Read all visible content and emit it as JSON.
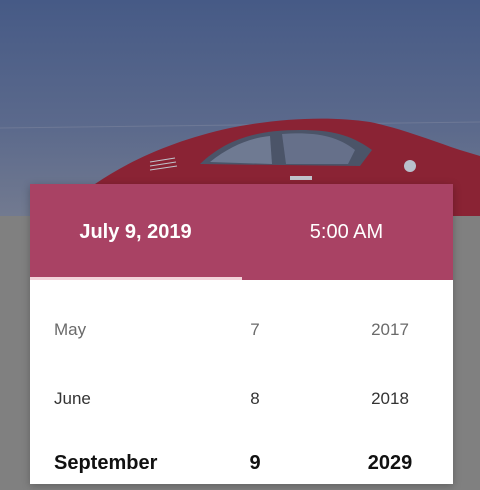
{
  "header": {
    "date_label": "July 9, 2019",
    "time_label": "5:00 AM"
  },
  "picker": {
    "months": [
      "May",
      "June",
      "September"
    ],
    "days": [
      "7",
      "8",
      "9"
    ],
    "years": [
      "2017",
      "2018",
      "2029"
    ]
  },
  "colors": {
    "header_bg": "#a94264",
    "tab_indicator": "#f3d3da",
    "backdrop": "#808080"
  }
}
